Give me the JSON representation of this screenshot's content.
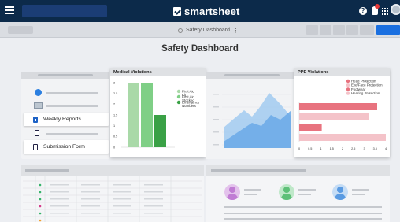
{
  "app": {
    "brand": "smartsheet"
  },
  "subbar": {
    "title": "Safety Dashboard",
    "title_caret": "⋮"
  },
  "dashboard": {
    "title": "Safety Dashboard"
  },
  "left_panel": {
    "items": [
      {
        "label": "Weekly Reports",
        "icon": "document-icon"
      },
      {
        "label": "Submission Form",
        "icon": "form-icon"
      }
    ]
  },
  "nav_icons": [
    "help-icon",
    "bell-icon",
    "apps-grid-icon",
    "avatar"
  ],
  "chart_data": [
    {
      "type": "bar",
      "title": "Medical Violations",
      "categories": [
        "First Aid Kit",
        "First Aid Stocked",
        "Emergency Numbers"
      ],
      "values": [
        3,
        3,
        1.5
      ],
      "colors": [
        "#a9d9a8",
        "#7fcf86",
        "#3aa146"
      ],
      "ylim": [
        0,
        3
      ],
      "yticks": [
        "3",
        "2.5",
        "2",
        "1.5",
        "1",
        "0.5",
        "0"
      ],
      "legend": [
        "First Aid Kit",
        "First Aid Stocked",
        "Emergency Numbers"
      ],
      "legend_position": "right"
    },
    {
      "type": "bar",
      "orientation": "horizontal",
      "title": "PPE Violations",
      "categories": [
        "Head Protection",
        "Eye/Face Protection",
        "Footwear",
        "Hearing Protection"
      ],
      "values": [
        4.5,
        4.0,
        1.3,
        5.0
      ],
      "colors": [
        "#e8737f",
        "#f4c3c9",
        "#e8737f",
        "#f4c3c9"
      ],
      "xlim": [
        0,
        5
      ],
      "xticks": [
        "0",
        "0.5",
        "1",
        "1.5",
        "2",
        "2.5",
        "3",
        "3.5",
        "4"
      ],
      "legend": [
        "Head Protection",
        "Eye/Face Protection",
        "Footwear",
        "Hearing Protection"
      ],
      "legend_position": "top-right"
    }
  ],
  "colors": {
    "nav": "#0c2a4a",
    "accent": "#1a6fe0"
  }
}
